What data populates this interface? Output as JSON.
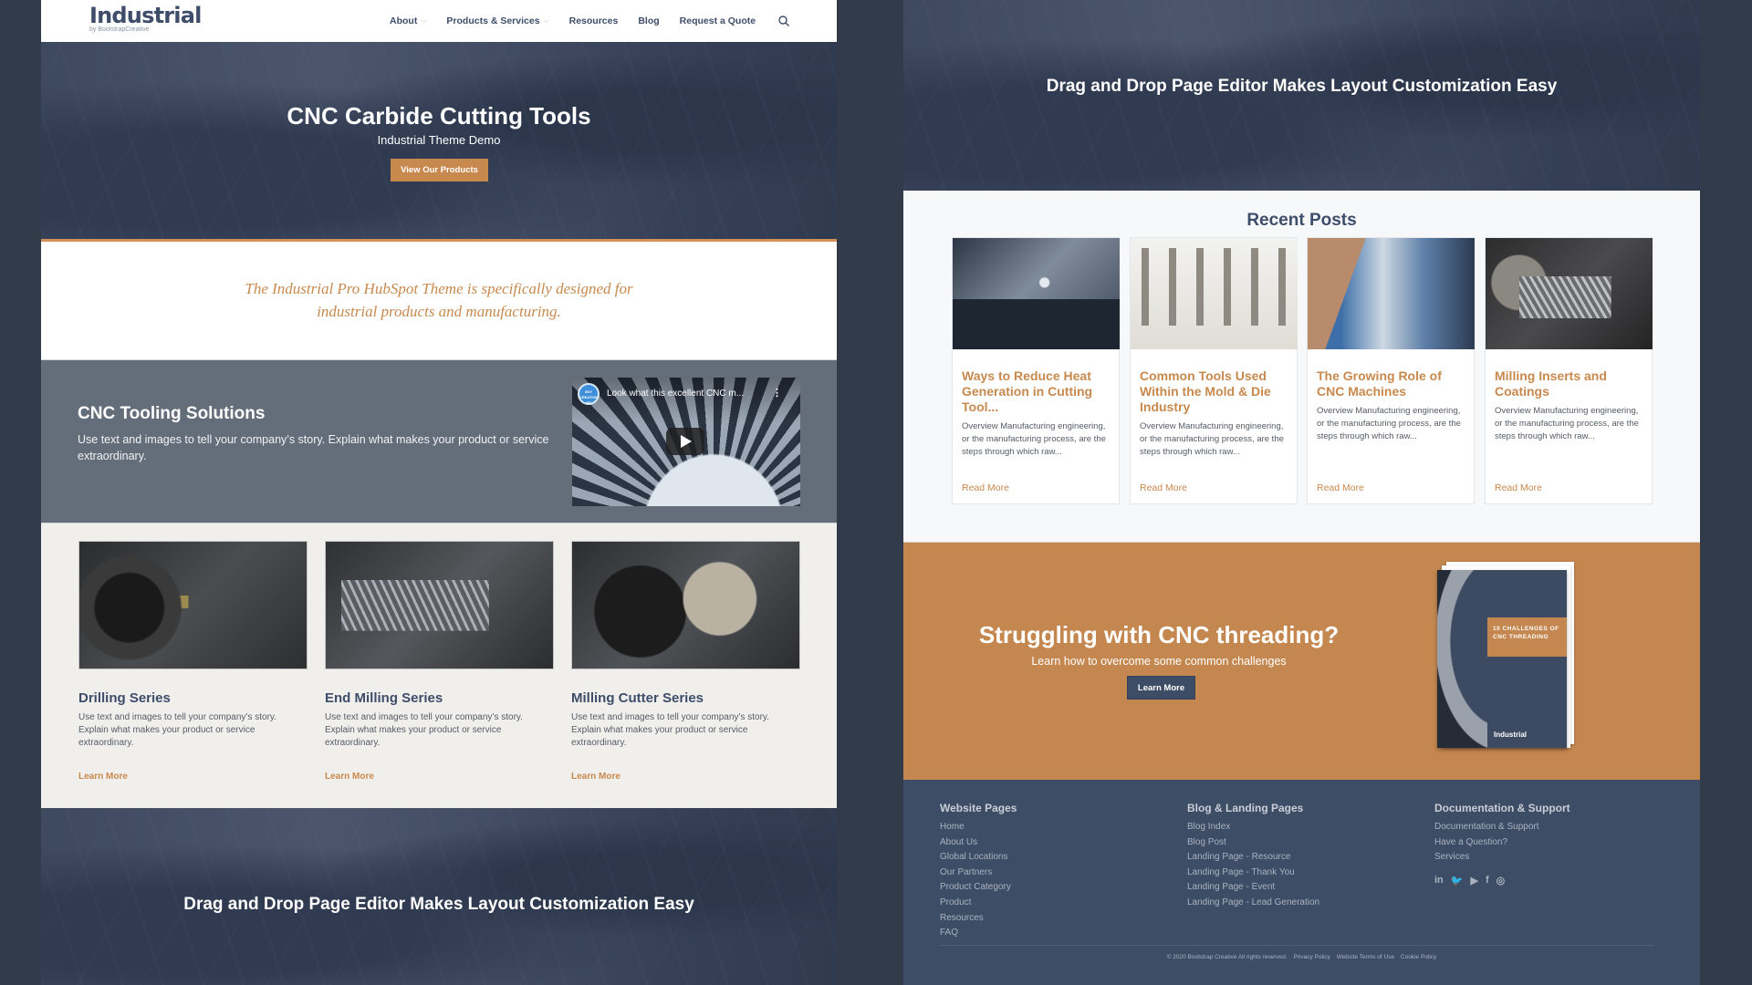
{
  "nav": {
    "logo": "Industrial",
    "logo_sub": "by BootstrapCreative",
    "items": [
      {
        "label": "About",
        "dropdown": true
      },
      {
        "label": "Products & Services",
        "dropdown": true
      },
      {
        "label": "Resources",
        "dropdown": false
      },
      {
        "label": "Blog",
        "dropdown": false
      },
      {
        "label": "Request a Quote",
        "dropdown": false
      }
    ],
    "search_icon": "search-icon"
  },
  "hero": {
    "title": "CNC Carbide Cutting Tools",
    "subtitle": "Industrial Theme Demo",
    "button": "View Our Products"
  },
  "intro": {
    "text": "The Industrial Pro HubSpot Theme is specifically designed for industrial products and manufacturing."
  },
  "tooling": {
    "title": "CNC Tooling Solutions",
    "text": "Use text and images to tell your company’s story. Explain what makes your product or service extraordinary.",
    "video": {
      "channel_badge": "SKY CREATIVE HD",
      "title": "Look what this excellent CNC m...",
      "menu_icon": "more-vert-icon",
      "play_icon": "play-icon"
    }
  },
  "products": [
    {
      "title": "Drilling Series",
      "text": "Use text and images to tell your company’s story. Explain what makes your product or service extraordinary.",
      "link": "Learn More"
    },
    {
      "title": "End Milling Series",
      "text": "Use text and images to tell your company’s story. Explain what makes your product or service extraordinary.",
      "link": "Learn More"
    },
    {
      "title": "Milling Cutter Series",
      "text": "Use text and images to tell your company’s story. Explain what makes your product or service extraordinary.",
      "link": "Learn More"
    }
  ],
  "drag_banner": {
    "title": "Drag and Drop Page Editor Makes Layout Customization Easy"
  },
  "recent_posts": {
    "heading": "Recent Posts",
    "posts": [
      {
        "title": "Ways to Reduce Heat Generation in Cutting Tool...",
        "excerpt": "Overview Manufacturing engineering, or the manufacturing process, are the steps through which raw...",
        "link": "Read More"
      },
      {
        "title": "Common Tools Used Within the Mold & Die Industry",
        "excerpt": "Overview Manufacturing engineering, or the manufacturing process, are the steps through which raw...",
        "link": "Read More"
      },
      {
        "title": "The Growing Role of CNC Machines",
        "excerpt": "Overview Manufacturing engineering, or the manufacturing process, are the steps through which raw...",
        "link": "Read More"
      },
      {
        "title": "Milling Inserts and Coatings",
        "excerpt": "Overview Manufacturing engineering, or the manufacturing process, are the steps through which raw...",
        "link": "Read More"
      }
    ]
  },
  "cta": {
    "title": "Struggling with CNC threading?",
    "subtitle": "Learn how to overcome some common challenges",
    "button": "Learn More",
    "ebook_title": "10 CHALLENGES OF CNC THREADING",
    "ebook_brand": "Industrial"
  },
  "footer": {
    "columns": [
      {
        "heading": "Website Pages",
        "links": [
          "Home",
          "About Us",
          "Global Locations",
          "Our Partners",
          "Product Category",
          "Product",
          "Resources",
          "FAQ"
        ]
      },
      {
        "heading": "Blog & Landing Pages",
        "links": [
          "Blog Index",
          "Blog Post",
          "Landing Page - Resource",
          "Landing Page - Thank You",
          "Landing Page - Event",
          "Landing Page - Lead Generation"
        ]
      },
      {
        "heading": "Documentation & Support",
        "links": [
          "Documentation & Support",
          "Have a Question?",
          "Services"
        ]
      }
    ],
    "socials": [
      {
        "name": "linkedin-icon",
        "glyph": "in"
      },
      {
        "name": "twitter-icon",
        "glyph": "🐦"
      },
      {
        "name": "youtube-icon",
        "glyph": "▶"
      },
      {
        "name": "facebook-icon",
        "glyph": "f"
      },
      {
        "name": "instagram-icon",
        "glyph": "◎"
      }
    ],
    "copyright": "© 2020 Bootstrap Creative All rights reserved.",
    "legal_links": [
      "Privacy Policy",
      "Website Terms of Use",
      "Cookie Policy"
    ]
  },
  "colors": {
    "accent": "#c8894e",
    "navy": "#3d4d66",
    "slate": "#646e7b",
    "background": "#323b4a"
  }
}
